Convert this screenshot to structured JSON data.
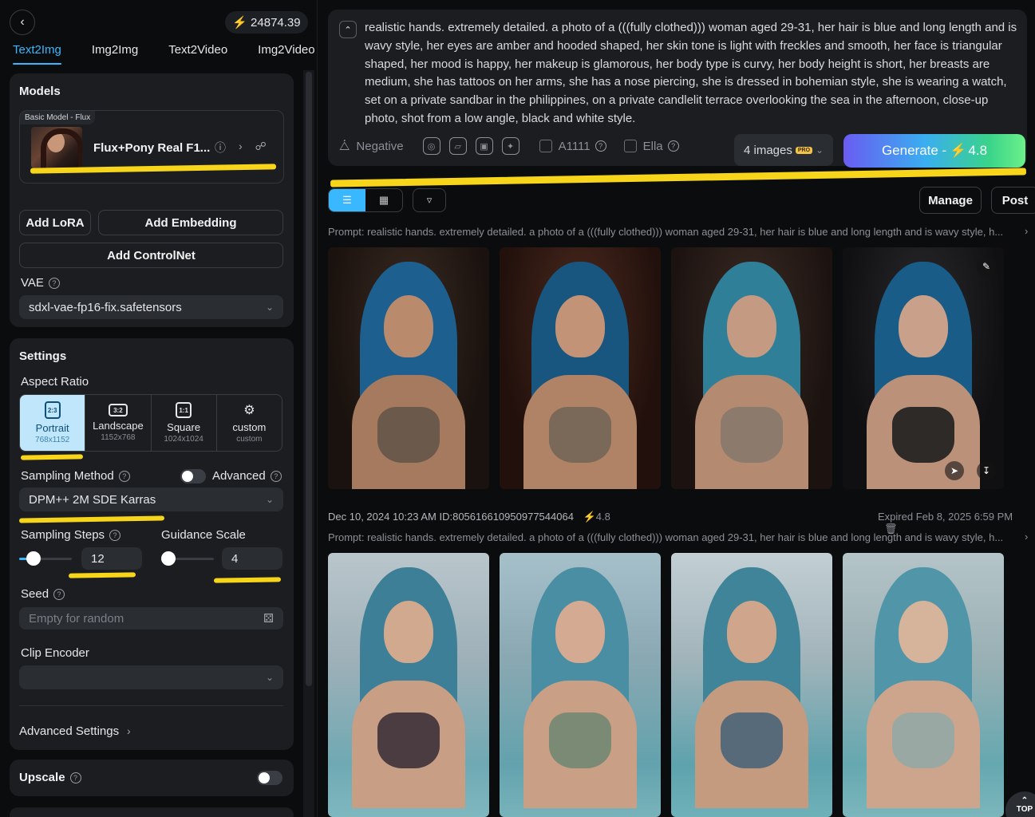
{
  "header": {
    "credits": "24874.39",
    "tabs": [
      "Text2Img",
      "Img2Img",
      "Text2Video",
      "Img2Video"
    ]
  },
  "models": {
    "title": "Models",
    "tag": "Basic Model - Flux",
    "model_name": "Flux+Pony Real F1..."
  },
  "buttons": {
    "add_lora": "Add LoRA",
    "add_embedding": "Add Embedding",
    "add_controlnet": "Add ControlNet"
  },
  "vae": {
    "label": "VAE",
    "value": "sdxl-vae-fp16-fix.safetensors"
  },
  "settings": {
    "title": "Settings",
    "aspect_label": "Aspect Ratio",
    "aspects": [
      {
        "icon": "2:3",
        "name": "Portrait",
        "size": "768x1152"
      },
      {
        "icon": "3:2",
        "name": "Landscape",
        "size": "1152x768"
      },
      {
        "icon": "1:1",
        "name": "Square",
        "size": "1024x1024"
      },
      {
        "icon": "",
        "name": "custom",
        "size": "custom"
      }
    ],
    "sampling_method_label": "Sampling Method",
    "advanced_label": "Advanced",
    "sampling_method": "DPM++ 2M SDE Karras",
    "steps_label": "Sampling Steps",
    "steps": "12",
    "guidance_label": "Guidance Scale",
    "guidance": "4",
    "seed_label": "Seed",
    "seed_placeholder": "Empty for random",
    "clip_label": "Clip Encoder",
    "advanced_settings": "Advanced Settings"
  },
  "upscale": {
    "label": "Upscale"
  },
  "prompt": {
    "text": "realistic hands. extremely detailed. a photo of a (((fully clothed))) woman aged 29-31, her hair is blue and long length and is wavy style, her eyes are amber and hooded shaped, her skin tone is light with freckles and smooth, her face is triangular shaped, her mood is happy, her makeup is glamorous, her body type is curvy, her body height is short, her breasts are medium, she has tattoos on her arms, she has a nose piercing, she is dressed in bohemian style, she is wearing a watch, set on a private sandbar in the philippines, on a private candlelit terrace overlooking the sea in the afternoon, close-up photo, shot from a low angle, black and white style.",
    "negative_label": "Negative",
    "a1111_label": "A1111",
    "ella_label": "Ella",
    "image_count": "4 images",
    "pro_badge": "PRO",
    "generate_label": "Generate -",
    "generate_cost": "4.8"
  },
  "toolbar": {
    "manage": "Manage",
    "post": "Post"
  },
  "results": [
    {
      "prompt": "Prompt: realistic hands. extremely detailed. a photo of a (((fully clothed))) woman aged 29-31, her hair is blue and long length and is wavy style, h..."
    },
    {
      "meta": "Dec 10, 2024 10:23 AM ID:805616610950977544064",
      "cost": "4.8",
      "expired": "Expired Feb 8, 2025 6:59 PM",
      "prompt": "Prompt: realistic hands. extremely detailed. a photo of a (((fully clothed))) woman aged 29-31, her hair is blue and long length and is wavy style, h..."
    }
  ],
  "scroll_top": "TOP",
  "colors": {
    "accent": "#3ab8ff",
    "highlight": "#f6d51a",
    "panel": "#1b1d21"
  }
}
